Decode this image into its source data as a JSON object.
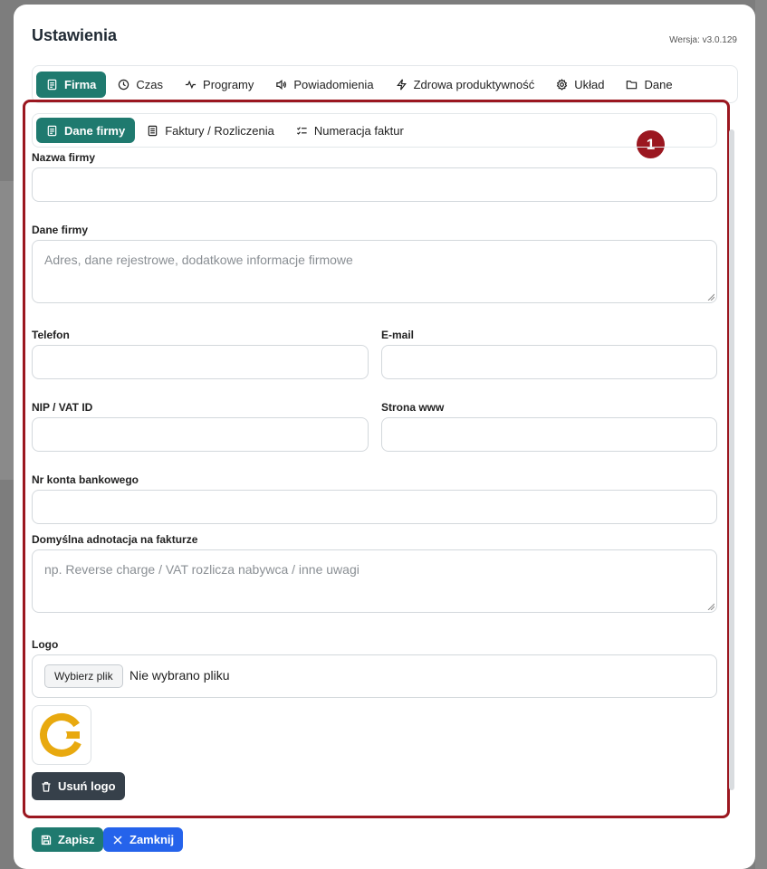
{
  "modal": {
    "title": "Ustawienia",
    "version": "Wersja: v3.0.129"
  },
  "main_tabs": [
    {
      "label": "Firma",
      "icon": "document-icon",
      "active": true
    },
    {
      "label": "Czas",
      "icon": "clock-icon"
    },
    {
      "label": "Programy",
      "icon": "activity-icon"
    },
    {
      "label": "Powiadomienia",
      "icon": "speaker-icon"
    },
    {
      "label": "Zdrowa produktywność",
      "icon": "bolt-icon"
    },
    {
      "label": "Układ",
      "icon": "gear-icon"
    },
    {
      "label": "Dane",
      "icon": "folder-icon"
    }
  ],
  "sub_tabs": [
    {
      "label": "Dane firmy",
      "icon": "document-icon",
      "active": true
    },
    {
      "label": "Faktury / Rozliczenia",
      "icon": "invoice-icon"
    },
    {
      "label": "Numeracja faktur",
      "icon": "list-check-icon"
    }
  ],
  "badge": "1",
  "form": {
    "company_name": {
      "label": "Nazwa firmy",
      "value": ""
    },
    "company_data": {
      "label": "Dane firmy",
      "placeholder": "Adres, dane rejestrowe, dodatkowe informacje firmowe"
    },
    "phone": {
      "label": "Telefon",
      "value": ""
    },
    "email": {
      "label": "E-mail",
      "value": ""
    },
    "nip": {
      "label": "NIP / VAT ID",
      "value": ""
    },
    "website": {
      "label": "Strona www",
      "value": ""
    },
    "bank_account": {
      "label": "Nr konta bankowego",
      "value": ""
    },
    "invoice_note": {
      "label": "Domyślna adnotacja na fakturze",
      "placeholder": "np. Reverse charge / VAT rozlicza nabywca / inne uwagi"
    },
    "logo": {
      "label": "Logo",
      "button": "Wybierz plik",
      "status": "Nie wybrano pliku"
    }
  },
  "buttons": {
    "remove_logo": "Usuń logo",
    "save": "Zapisz",
    "close": "Zamknij"
  },
  "colors": {
    "accent": "#1f7a6f",
    "primary": "#2563eb",
    "highlight": "#9b1720",
    "dark": "#36404a",
    "logo": "#e8a90f"
  }
}
